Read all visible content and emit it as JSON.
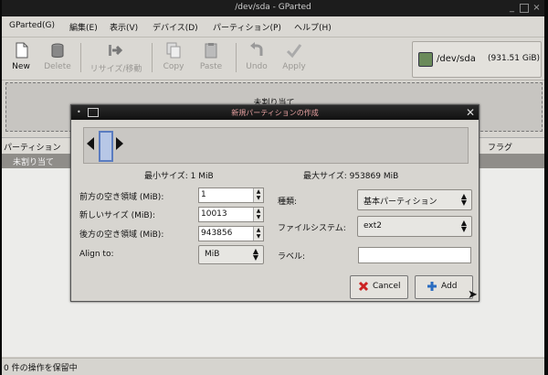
{
  "window": {
    "title": "/dev/sda - GParted"
  },
  "menubar": [
    {
      "label": "GParted(G)"
    },
    {
      "label": "編集(E)"
    },
    {
      "label": "表示(V)"
    },
    {
      "label": "デバイス(D)"
    },
    {
      "label": "パーティション(P)"
    },
    {
      "label": "ヘルプ(H)"
    }
  ],
  "toolbar": {
    "new": "New",
    "delete": "Delete",
    "resize_move": "リサイズ/移動",
    "copy": "Copy",
    "paste": "Paste",
    "undo": "Undo",
    "apply": "Apply",
    "device": "/dev/sda",
    "device_size": "(931.51 GiB)"
  },
  "graph": {
    "unallocated_label": "未割り当て"
  },
  "partition_list": {
    "columns": [
      "パーティション",
      "フラグ"
    ],
    "rows": [
      {
        "partition": "未割り当て"
      }
    ]
  },
  "status": {
    "text": "0 件の操作を保留中"
  },
  "dialog": {
    "title": "新規パーティションの作成",
    "min_size": "最小サイズ: 1 MiB",
    "max_size": "最大サイズ: 953869 MiB",
    "fields": {
      "free_before_label": "前方の空き領域 (MiB):",
      "free_before_value": "1",
      "new_size_label": "新しいサイズ (MiB):",
      "new_size_value": "10013",
      "free_after_label": "後方の空き領域 (MiB):",
      "free_after_value": "943856",
      "align_label": "Align to:",
      "align_value": "MiB",
      "type_label": "種類:",
      "type_value": "基本パーティション",
      "fs_label": "ファイルシステム:",
      "fs_value": "ext2",
      "label_label": "ラベル:",
      "label_value": ""
    },
    "cancel": "Cancel",
    "add": "Add"
  }
}
